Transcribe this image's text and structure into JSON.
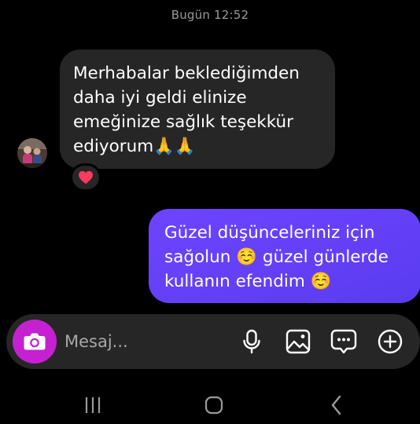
{
  "header": {
    "timestamp": "Bugün 12:52"
  },
  "messages": [
    {
      "direction": "incoming",
      "text": "Merhabalar beklediğimden\ndaha iyi geldi elinize\nemeğinize sağlık teşekkür\nediyorum🙏🙏",
      "reaction": "heart"
    },
    {
      "direction": "outgoing",
      "text": "Güzel düşünceleriniz için\nsağolun ☺️ güzel günlerde\nkullanın efendim ☺️"
    }
  ],
  "composer": {
    "placeholder": "Mesaj...",
    "value": "",
    "buttons": [
      "camera-icon",
      "microphone-icon",
      "gallery-icon",
      "sticker-icon",
      "plus-circle-icon"
    ]
  },
  "colors": {
    "background": "#000000",
    "incoming_bubble": "#262626",
    "outgoing_bubble": "#6a3ef5",
    "camera_button": "#c521d1",
    "heart": "#ff3b5c"
  },
  "navigation": {
    "buttons": [
      "recents-icon",
      "home-icon",
      "back-icon"
    ]
  }
}
